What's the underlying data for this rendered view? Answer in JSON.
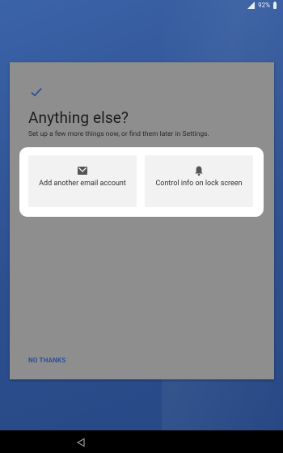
{
  "status_bar": {
    "battery_percent": "92%"
  },
  "dialog": {
    "title": "Anything else?",
    "subtitle": "Set up a few more things now, or find them later in Settings.",
    "options": [
      {
        "label": "Add another email account",
        "icon": "mail-icon"
      },
      {
        "label": "Control info on lock screen",
        "icon": "bell-icon"
      }
    ],
    "dismiss_label": "NO THANKS"
  },
  "nav_bar": {
    "back_icon": "back-triangle-icon"
  },
  "colors": {
    "background": "#2f5392",
    "card": "#8e8e8e",
    "accent": "#2a4f9a",
    "option_bg": "#f2f2f2"
  }
}
